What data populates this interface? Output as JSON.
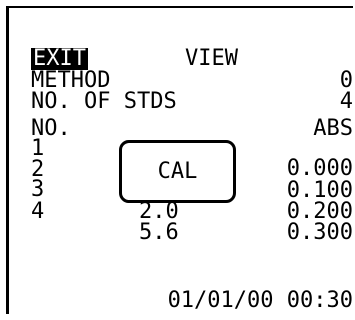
{
  "header": {
    "exit_label": "EXIT",
    "title": "VIEW"
  },
  "rows": [
    {
      "label": "METHOD",
      "value": "0"
    },
    {
      "label": "NO. OF STDS",
      "value": "4"
    }
  ],
  "table": {
    "col_no": "NO.",
    "col_abs": "ABS",
    "data": [
      {
        "no": "1",
        "conc": "",
        "abs": "0.000"
      },
      {
        "no": "2",
        "conc": "",
        "abs": "0.100"
      },
      {
        "no": "3",
        "conc": "2.0",
        "abs": "0.200"
      },
      {
        "no": "4",
        "conc": "5.6",
        "abs": "0.300"
      }
    ]
  },
  "dialog": {
    "label": "CAL"
  },
  "footer": {
    "datetime": "01/01/00 00:30"
  }
}
